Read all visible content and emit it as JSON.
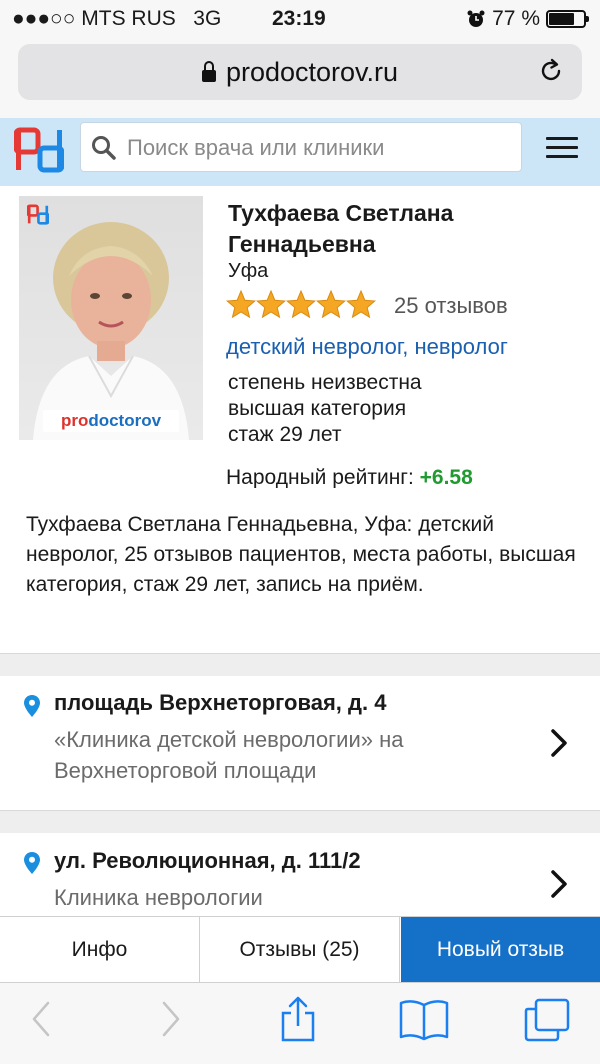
{
  "status_bar": {
    "signal": "●●●○○",
    "carrier": "MTS RUS",
    "network": "3G",
    "time": "23:19",
    "battery": "77 %",
    "battery_level": 0.77,
    "alarm_icon": "alarm-clock-icon"
  },
  "browser": {
    "url": "prodoctorov.ru",
    "lock_icon": "lock-icon",
    "reload_icon": "reload-icon"
  },
  "site_header": {
    "logo_icon": "prodoctorov-logo-icon",
    "search_placeholder": "Поиск врача или клиники",
    "menu_icon": "hamburger-menu-icon",
    "background": "#cde6f7"
  },
  "doctor": {
    "photo_watermark_pro": "pro",
    "photo_watermark_doctorov": "doctorov",
    "name_line1": "Тухфаева Светлана",
    "name_line2": "Геннадьевна",
    "city": "Уфа",
    "stars": 5,
    "reviews": "25 отзывов",
    "specialty1": "детский невролог",
    "specialty_separator": ",",
    "specialty2": "невролог",
    "degree": "степень неизвестна",
    "category": "высшая категория",
    "experience": "стаж 29 лет",
    "rating_label": "Народный рейтинг:",
    "rating_value": "+6.58",
    "description": "Тухфаева Светлана Геннадьевна, Уфа: детский невролог, 25 отзывов пациентов, места работы, высшая категория, стаж 29 лет, запись на приём."
  },
  "addresses": [
    {
      "street": "площадь Верхнеторговая, д. 4",
      "clinic": "«Клиника детской неврологии» на Верхнеторговой площади"
    },
    {
      "street": "ул. Революционная, д. 111/2",
      "clinic": "Клиника неврологии"
    }
  ],
  "tabs": {
    "info": "Инфо",
    "reviews": "Отзывы (25)",
    "new_review": "Новый отзыв"
  },
  "toolbar": {
    "back_icon": "back-chevron-icon",
    "forward_icon": "forward-chevron-icon",
    "share_icon": "share-icon",
    "bookmarks_icon": "book-icon",
    "tabs_icon": "tabs-icon"
  },
  "colors": {
    "link_blue": "#1a5fb0",
    "rating_green": "#219a2f",
    "star_orange": "#f5a623",
    "primary_button": "#1570c8",
    "pin_blue": "#1a8fe0"
  }
}
